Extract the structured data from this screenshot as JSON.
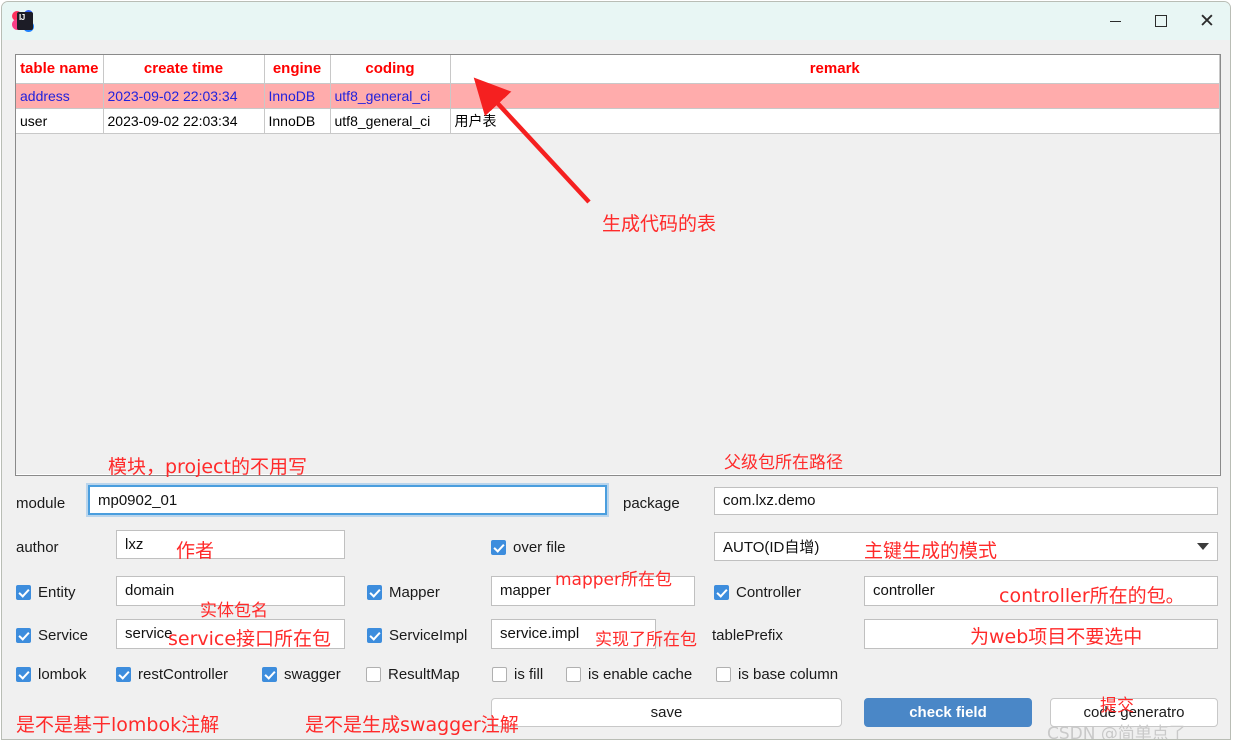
{
  "window": {
    "icon": "intellij-idea-logo",
    "controls": {
      "minimize": "minimize-icon",
      "maximize": "maximize-icon",
      "close": "close-icon"
    }
  },
  "table": {
    "headers": [
      "table name",
      "create time",
      "engine",
      "coding",
      "remark"
    ],
    "rows": [
      {
        "name": "address",
        "create_time": "2023-09-02 22:03:34",
        "engine": "InnoDB",
        "coding": "utf8_general_ci",
        "remark": "",
        "selected": true
      },
      {
        "name": "user",
        "create_time": "2023-09-02 22:03:34",
        "engine": "InnoDB",
        "coding": "utf8_general_ci",
        "remark": "用户表",
        "selected": false
      }
    ]
  },
  "form": {
    "module_label": "module",
    "module_value": "mp0902_01",
    "package_label": "package",
    "package_value": "com.lxz.demo",
    "author_label": "author",
    "author_value": "lxz",
    "over_file_label": "over file",
    "id_type_value": "AUTO(ID自增)",
    "entity_label": "Entity",
    "entity_value": "domain",
    "mapper_label": "Mapper",
    "mapper_value": "mapper",
    "controller_label": "Controller",
    "controller_value": "controller",
    "service_label": "Service",
    "service_value": "service",
    "service_impl_label": "ServiceImpl",
    "service_impl_value": "service.impl",
    "table_prefix_label": "tablePrefix",
    "table_prefix_value": "",
    "lombok_label": "lombok",
    "rest_controller_label": "restController",
    "swagger_label": "swagger",
    "result_map_label": "ResultMap",
    "is_fill_label": "is fill",
    "is_enable_cache_label": "is enable cache",
    "is_base_column_label": "is base column",
    "save_label": "save",
    "check_field_label": "check field",
    "code_generator_label": "code generatro"
  },
  "annotations": {
    "gen_table": "生成代码的表",
    "module_hint": "模块，project的不用写",
    "package_hint": "父级包所在路径",
    "author_hint": "作者",
    "id_type_hint": "主键生成的模式",
    "entity_hint": "实体包名",
    "mapper_hint": "mapper所在包",
    "controller_hint": "controller所在的包。",
    "service_hint": "service接口所在包",
    "service_impl_hint": "实现了所在包",
    "table_prefix_hint": "为web项目不要选中",
    "lombok_hint": "是不是基于lombok注解",
    "swagger_hint": "是不是生成swagger注解",
    "submit_hint": "提交"
  },
  "watermark": "CSDN @简单点了",
  "colors": {
    "titlebar": "#e8f6f4",
    "selected_row": "#ffacac",
    "header_text": "#ff0000",
    "annotation": "#ff2a2a",
    "primary_button": "#4a87c7",
    "checkbox_on": "#3d8ddd"
  }
}
